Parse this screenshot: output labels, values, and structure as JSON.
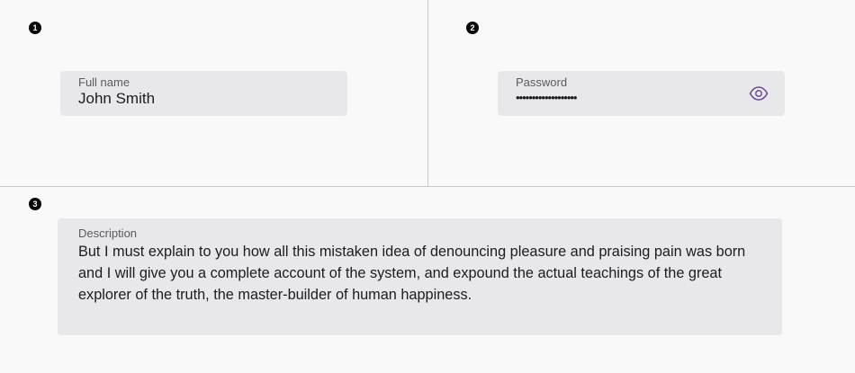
{
  "markers": [
    "1",
    "2",
    "3"
  ],
  "full_name_field": {
    "label": "Full name",
    "value": "John Smith"
  },
  "password_field": {
    "label": "Password",
    "masked_value": "•••••••••••••••••••",
    "toggle_icon": "eye-icon",
    "accent_color": "#6b4c9a"
  },
  "description_field": {
    "label": "Description",
    "value": "But I must explain to you how all this mistaken idea of denouncing pleasure and praising pain was born and I will give you a complete account of the system, and expound the actual teachings of the great explorer of the truth, the master-builder of human happiness."
  }
}
